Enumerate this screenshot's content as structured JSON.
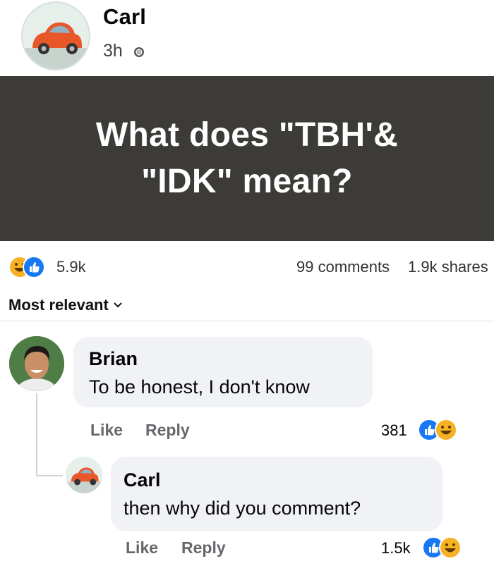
{
  "post": {
    "author": "Carl",
    "time": "3h",
    "text": "What does \"TBH'& \"IDK\" mean?"
  },
  "stats": {
    "reactions": "5.9k",
    "comments": "99 comments",
    "shares": "1.9k shares"
  },
  "sort": {
    "label": "Most relevant"
  },
  "comments": [
    {
      "author": "Brian",
      "text": "To be honest, I don't know",
      "like_label": "Like",
      "reply_label": "Reply",
      "reactions": "381"
    },
    {
      "author": "Carl",
      "text": "then why did you comment?",
      "like_label": "Like",
      "reply_label": "Reply",
      "reactions": "1.5k"
    }
  ],
  "icons": [
    "car-avatar-icon",
    "globe-icon",
    "like-reaction-icon",
    "haha-reaction-icon",
    "chevron-down-icon"
  ],
  "colors": {
    "like_blue": "#1877f2",
    "haha_yellow": "#f7b125",
    "card_bg": "#3c3b38"
  }
}
